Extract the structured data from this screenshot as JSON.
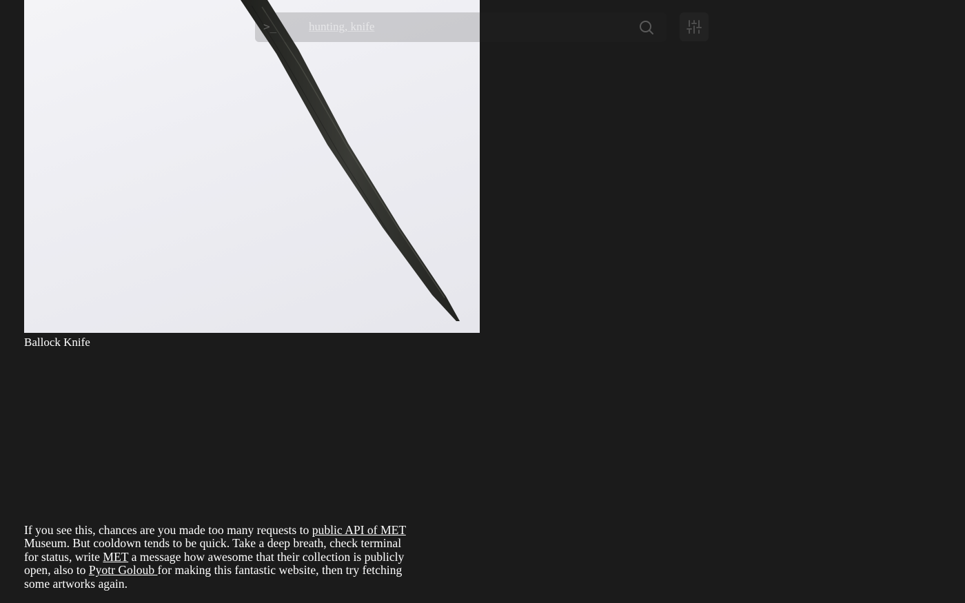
{
  "search": {
    "prompt_glyph": ">_",
    "value": "hunting, knife"
  },
  "icons": {
    "search": "search-icon",
    "filter": "sliders-icon"
  },
  "artwork": {
    "title": "Ballock Knife"
  },
  "message": {
    "part1": "If you see this, chances are you made too many requests to ",
    "link1": "public API of MET",
    "part2": " Museum. But cooldown tends to be quick. Take a deep breath, check terminal for status, write ",
    "link2": "MET",
    "part3": " a message how awesome that their collection is publicly open, also to ",
    "link3": "Pyotr Goloub ",
    "part4": "for making this fantastic website, then try fetching some artworks again."
  },
  "colors": {
    "background": "#1b1b1b",
    "text": "#ffffff",
    "image_background": "#efeff3",
    "blade": "#2f302c"
  }
}
